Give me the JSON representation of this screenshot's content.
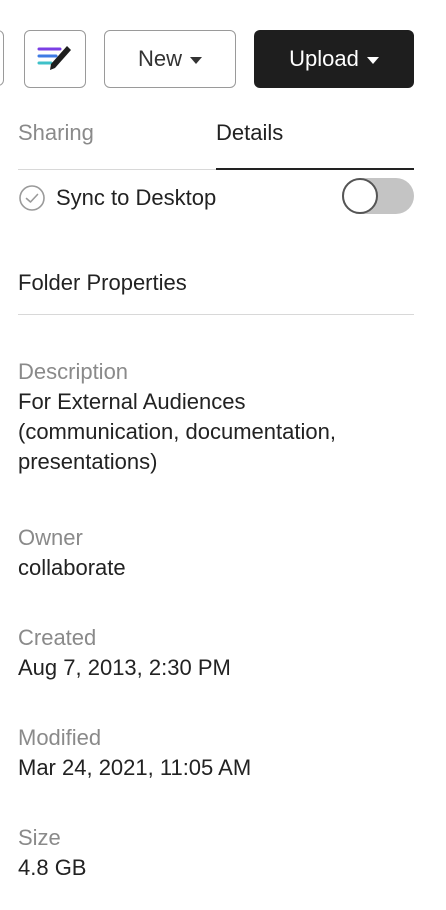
{
  "toolbar": {
    "new_label": "New",
    "upload_label": "Upload"
  },
  "tabs": [
    {
      "label": "Sharing",
      "active": false
    },
    {
      "label": "Details",
      "active": true
    }
  ],
  "sync": {
    "label": "Sync to Desktop",
    "enabled": false
  },
  "folder_properties": {
    "title": "Folder Properties",
    "description_label": "Description",
    "description_lines": [
      "For External Audiences",
      "(communication, documentation,",
      "presentations)"
    ],
    "owner_label": "Owner",
    "owner_value": "collaborate",
    "created_label": "Created",
    "created_value": "Aug 7, 2013, 2:30 PM",
    "modified_label": "Modified",
    "modified_value": "Mar 24, 2021, 11:05 AM",
    "size_label": "Size",
    "size_value": "4.8 GB"
  },
  "colors": {
    "upload_bg": "#1e1e1e",
    "muted_text": "#8a8a8a",
    "toggle_off": "#c4c4c4",
    "icon_purple": "#7b3fe4",
    "icon_teal": "#3fc1c9",
    "icon_blue": "#3f7be4"
  }
}
